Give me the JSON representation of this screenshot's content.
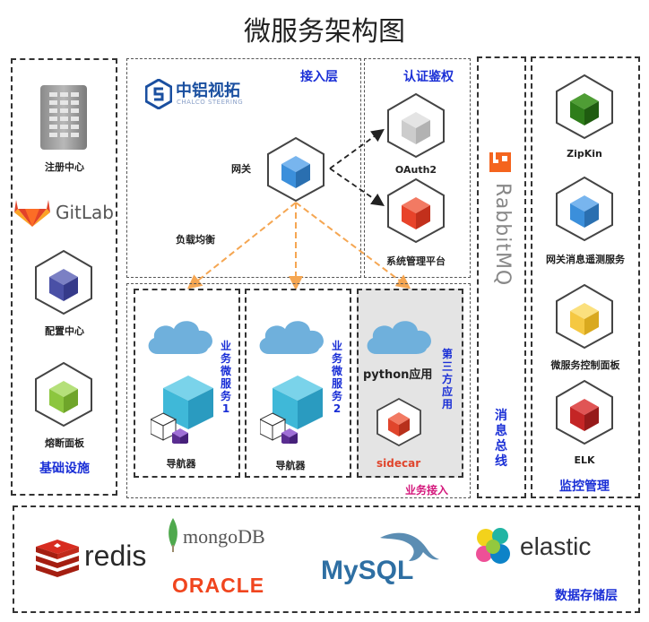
{
  "title": "微服务架构图",
  "base": {
    "registry": "注册中心",
    "gitlab": "GitLab",
    "config": "配置中心",
    "breaker": "熔断面板",
    "layer": "基础设施"
  },
  "access": {
    "brand_cn": "中铝视拓",
    "brand_en": "CHALCO STEERING",
    "layer": "接入层",
    "gateway": "网关",
    "lb": "负载均衡"
  },
  "auth": {
    "layer": "认证鉴权",
    "oauth": "OAuth2",
    "sysmgmt": "系统管理平台"
  },
  "business": {
    "svc1": "业务微服务1",
    "svc2": "业务微服务2",
    "nav1": "导航器",
    "nav2": "导航器",
    "python": "python应用",
    "third": "第三方应用",
    "sidecar": "sidecar",
    "layer": "业务接入"
  },
  "bus": {
    "rabbit": "RabbitMQ",
    "layer": "消息总线"
  },
  "monitor": {
    "zipkin": "ZipKin",
    "gateway_tel": "网关消息遥测服务",
    "dashboard": "微服务控制面板",
    "elk": "ELK",
    "layer": "监控管理"
  },
  "storage": {
    "redis": "redis",
    "mongo": "mongoDB",
    "oracle": "ORACLE",
    "mysql": "MySQL",
    "elastic": "elastic",
    "layer": "数据存储层"
  },
  "colors": {
    "layer_text": "#1a2fd6",
    "arrow_orange": "#f5a652",
    "cube_blue": "#3b8fdb",
    "cube_green": "#2e7d1a",
    "cube_red": "#e8432a",
    "cube_yellow": "#f5c842",
    "cube_darkred": "#c42525",
    "cube_lightgreen": "#8cc63f",
    "cube_purple": "#4a50a6",
    "cube_gray": "#cccccc",
    "sidecar_red": "#e0452c",
    "rabbit_orange": "#f4641e",
    "oracle_red": "#f0451e"
  }
}
